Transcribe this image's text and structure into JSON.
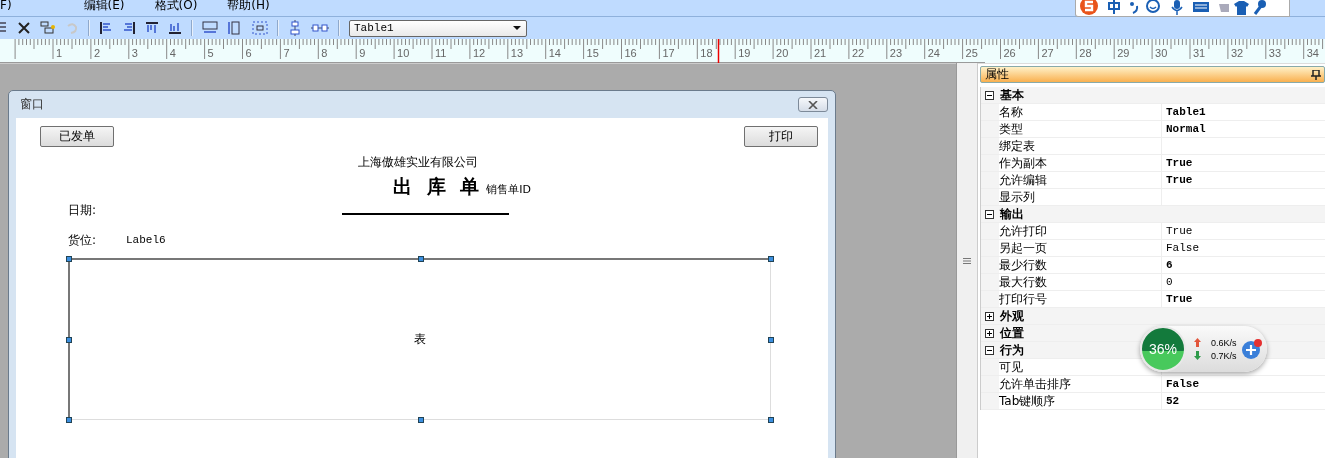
{
  "menu": [
    "F)",
    "编辑(E)",
    "格式(O)",
    "帮助(H)"
  ],
  "toolbar": {
    "object_select": {
      "value": "Table1"
    }
  },
  "ruler": {
    "numbers": [
      "1",
      "2",
      "3",
      "4",
      "5",
      "6",
      "7",
      "8",
      "9",
      "10",
      "11",
      "12",
      "13",
      "14",
      "15",
      "16",
      "17",
      "18",
      "19",
      "20",
      "21",
      "22",
      "23",
      "24",
      "25",
      "26",
      "27",
      "28",
      "29",
      "30",
      "31",
      "32",
      "33",
      "34"
    ]
  },
  "window": {
    "title": "窗口",
    "buttons": [
      {
        "label": "已发单"
      },
      {
        "label": "打印"
      }
    ],
    "company": "上海傲雄实业有限公司",
    "form_title": "出 库 单",
    "form_id": "销售单ID",
    "fields": [
      {
        "label": "日期:"
      },
      {
        "label": "货位:",
        "value": "Label6"
      }
    ],
    "table": {
      "label": "表",
      "selected": true
    }
  },
  "properties": {
    "title": "属性",
    "groups": [
      {
        "name": "基本",
        "expanded": true,
        "rows": [
          {
            "name": "名称",
            "value": "Table1",
            "bold": true
          },
          {
            "name": "类型",
            "value": "Normal",
            "bold": true
          },
          {
            "name": "绑定表",
            "bold": false
          },
          {
            "name": "作为副本",
            "value": "True",
            "bold": true
          },
          {
            "name": "允许编辑",
            "value": "True",
            "bold": true
          },
          {
            "name": "显示列",
            "bold": false
          }
        ]
      },
      {
        "name": "输出",
        "expanded": true,
        "rows": [
          {
            "name": "允许打印",
            "value": "True",
            "bold": false
          },
          {
            "name": "另起一页",
            "value": "False",
            "bold": false
          },
          {
            "name": "最少行数",
            "value": "6",
            "bold": true
          },
          {
            "name": "最大行数",
            "value": "0",
            "bold": false
          },
          {
            "name": "打印行号",
            "value": "True",
            "bold": true
          }
        ]
      },
      {
        "name": "外观",
        "expanded": false
      },
      {
        "name": "位置",
        "expanded": false
      },
      {
        "name": "行为",
        "expanded": true,
        "rows": [
          {
            "name": "可见",
            "bold": false
          },
          {
            "name": "允许单击排序",
            "value": "False",
            "bold": true
          },
          {
            "name": "Tab键顺序",
            "value": "52",
            "bold": true
          }
        ]
      }
    ]
  },
  "net_widget": {
    "percent": "36%",
    "upload": "0.6K/s",
    "download": "0.7K/s"
  }
}
